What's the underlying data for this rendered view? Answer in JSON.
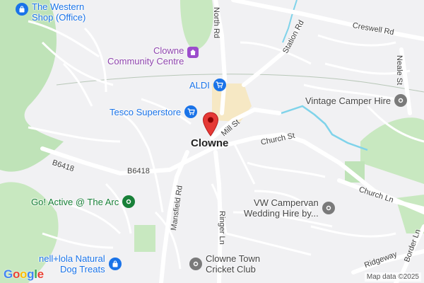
{
  "map": {
    "town": "Clowne",
    "attribution": "Map data ©2025",
    "logo": {
      "letters": [
        "G",
        "o",
        "o",
        "g",
        "l",
        "e"
      ],
      "colors": [
        "#4285F4",
        "#EA4335",
        "#FBBC05",
        "#4285F4",
        "#34A853",
        "#EA4335"
      ]
    },
    "colors": {
      "background": "#f1f1f3",
      "green": "#bfe3b8",
      "water": "#7fd3ea",
      "town_centre": "#f6e8c4",
      "shop_pin": "#1a73e8",
      "marker": "#e53935"
    },
    "roads": {
      "north_rd": "North Rd",
      "station_rd": "Station Rd",
      "creswell_rd": "Creswell Rd",
      "neale_st": "Neale St",
      "mill_st": "Mill St",
      "church_st": "Church St",
      "b6418_west": "B6418",
      "b6418_east": "B6418",
      "mansfield_rd": "Mansfield Rd",
      "ringer_ln": "Ringer Ln",
      "church_ln": "Church Ln",
      "ridgeway": "Ridgeway",
      "border_ln": "Border Ln"
    },
    "places": {
      "western_shop": {
        "line1": "The Western",
        "line2": "Shop (Office)",
        "icon": "shopping-bag-icon"
      },
      "community_centre": {
        "line1": "Clowne",
        "line2": "Community Centre",
        "icon": "community-centre-icon"
      },
      "aldi": {
        "label": "ALDI",
        "icon": "shopping-cart-icon"
      },
      "tesco": {
        "label": "Tesco Superstore",
        "icon": "shopping-cart-icon"
      },
      "vintage_camper": {
        "label": "Vintage Camper Hire",
        "icon": "location-icon"
      },
      "go_active": {
        "label": "Go! Active @ The Arc",
        "icon": "location-icon"
      },
      "vw_campervan": {
        "line1": "VW Campervan",
        "line2": "Wedding Hire by...",
        "icon": "location-icon"
      },
      "nell_iola": {
        "line1": "nell+lola Natural",
        "line2": "Dog Treats",
        "icon": "shopping-bag-icon"
      },
      "cricket_club": {
        "line1": "Clowne Town",
        "line2": "Cricket Club",
        "icon": "location-icon"
      }
    }
  }
}
